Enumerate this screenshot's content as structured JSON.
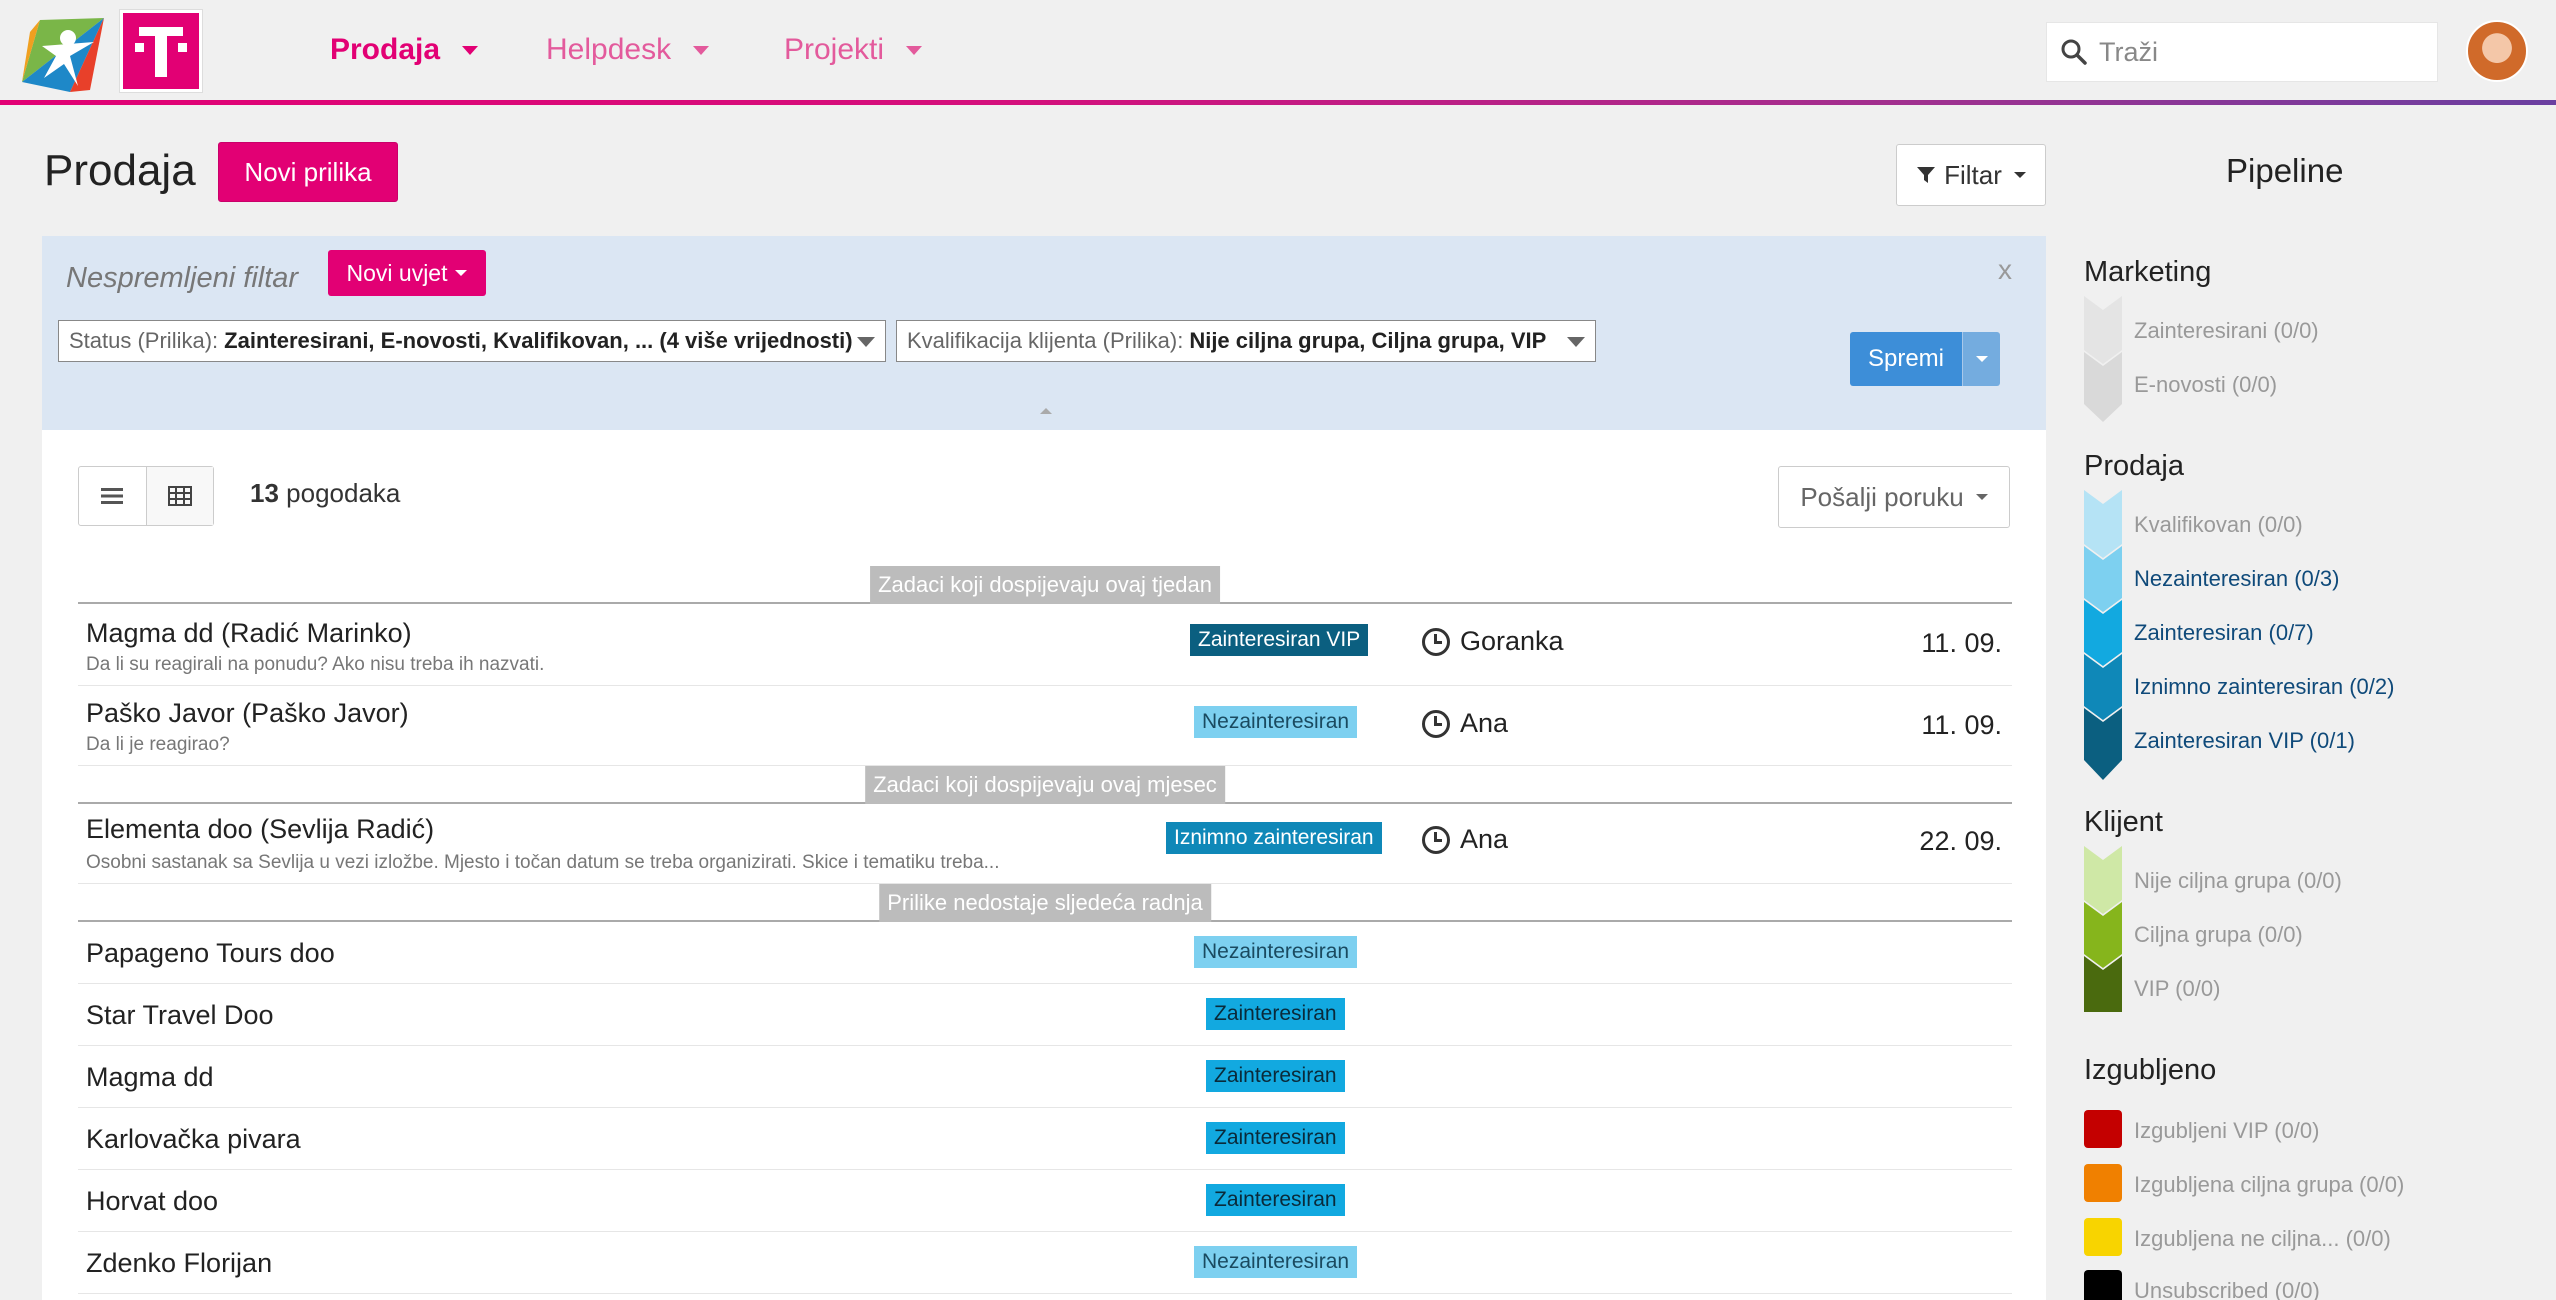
{
  "nav": {
    "items": [
      {
        "label": "Prodaja"
      },
      {
        "label": "Helpdesk"
      },
      {
        "label": "Projekti"
      }
    ],
    "search_placeholder": "Traži"
  },
  "header": {
    "title": "Prodaja",
    "new_button": "Novi prilika",
    "filter_button": "Filtar"
  },
  "filter": {
    "label": "Nespremljeni filtar",
    "new_condition": "Novi uvjet",
    "close": "x",
    "conditions": [
      {
        "field": "Status (Prilika):",
        "value": "Zainteresirani, E-novosti, Kvalifikovan, ... (4 više vrijednosti)"
      },
      {
        "field": "Kvalifikacija klijenta (Prilika):",
        "value": "Nije ciljna grupa, Ciljna grupa, VIP"
      }
    ],
    "save": "Spremi"
  },
  "list": {
    "hits_count": "13",
    "hits_label": "pogodaka",
    "send_button": "Pošalji poruku",
    "sections": [
      {
        "title": "Zadaci koji dospijevaju ovaj tjedan"
      },
      {
        "title": "Zadaci koji dospijevaju ovaj mjesec"
      },
      {
        "title": "Prilike nedostaje sljedeća radnja"
      }
    ],
    "rows": [
      {
        "title": "Magma dd (Radić Marinko)",
        "sub": "Da li su reagirali na ponudu? Ako nisu treba ih nazvati.",
        "status": "Zainteresiran VIP",
        "who": "Goranka",
        "date": "11. 09."
      },
      {
        "title": "Paško Javor (Paško Javor)",
        "sub": "Da li je reagirao?",
        "status": "Nezainteresiran",
        "who": "Ana",
        "date": "11. 09."
      },
      {
        "title": "Elementa doo (Sevlija Radić)",
        "sub": "Osobni sastanak sa Sevlija u vezi izložbe. Mjesto i točan datum se treba organizirati. Skice i tematiku treba...",
        "status": "Iznimno zainteresiran",
        "who": "Ana",
        "date": "22. 09."
      },
      {
        "title": "Papageno Tours doo",
        "status": "Nezainteresiran"
      },
      {
        "title": "Star Travel Doo",
        "status": "Zainteresiran"
      },
      {
        "title": "Magma dd",
        "status": "Zainteresiran"
      },
      {
        "title": "Karlovačka pivara",
        "status": "Zainteresiran"
      },
      {
        "title": "Horvat doo",
        "status": "Zainteresiran"
      },
      {
        "title": "Zdenko Florijan",
        "status": "Nezainteresiran"
      }
    ]
  },
  "pipeline": {
    "title": "Pipeline",
    "groups": [
      {
        "title": "Marketing",
        "items": [
          {
            "label": "Zainteresirani (0/0)",
            "color": "#e4e4e4"
          },
          {
            "label": "E-novosti (0/0)",
            "color": "#d9d9d9"
          }
        ]
      },
      {
        "title": "Prodaja",
        "items": [
          {
            "label": "Kvalifikovan (0/0)",
            "color": "#b5e3f5"
          },
          {
            "label": "Nezainteresiran (0/3)",
            "color": "#7dd0f0"
          },
          {
            "label": "Zainteresiran (0/7)",
            "color": "#12a9e0"
          },
          {
            "label": "Iznimno zainteresiran (0/2)",
            "color": "#0f88b8"
          },
          {
            "label": "Zainteresiran VIP (0/1)",
            "color": "#0b5f80"
          }
        ]
      },
      {
        "title": "Klijent",
        "items": [
          {
            "label": "Nije ciljna grupa (0/0)",
            "color": "#cfe8a6"
          },
          {
            "label": "Ciljna grupa (0/0)",
            "color": "#86b51c"
          },
          {
            "label": "VIP (0/0)",
            "color": "#4a6a0e"
          }
        ]
      },
      {
        "title": "Izgubljeno",
        "items": [
          {
            "label": "Izgubljeni VIP (0/0)",
            "color": "#c40000"
          },
          {
            "label": "Izgubljena ciljna grupa (0/0)",
            "color": "#f08000"
          },
          {
            "label": "Izgubljena ne ciljna... (0/0)",
            "color": "#f8d400"
          },
          {
            "label": "Unsubscribed (0/0)",
            "color": "#000000"
          }
        ]
      }
    ]
  },
  "colors": {
    "brand": "#e20074",
    "save_blue": "#3d8ed8",
    "status_vip": "#0b5f80",
    "status_nezainteresiran": "#7dd0f0",
    "status_iznimno": "#0f88b8",
    "status_zainteresiran": "#12a9e0"
  }
}
